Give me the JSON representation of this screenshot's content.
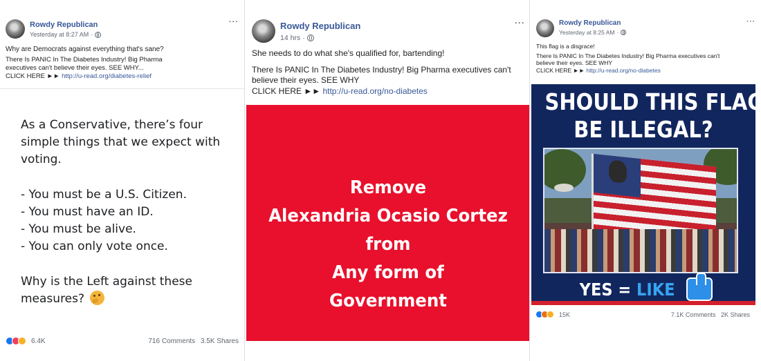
{
  "posts": [
    {
      "page_name": "Rowdy Republican",
      "timestamp": "Yesterday at 8:27 AM",
      "more": "···",
      "caption_question": "Why are Democrats against everything that's sane?",
      "ad_line1": "There Is PANIC In The Diabetes Industry! Big Pharma",
      "ad_line2": "executives can't believe their eyes. SEE WHY...",
      "click_label": "CLICK HERE ►► ",
      "link": "http://u-read.org/diabetes-relief",
      "card_lines": [
        "As a Conservative, there’s four",
        "simple things that we expect with",
        "voting.",
        "",
        "- You must be a U.S. Citizen.",
        "- You must have an ID.",
        "- You must be alive.",
        "- You can only vote once.",
        "",
        "Why is the Left against these",
        "measures?"
      ],
      "reactions": {
        "icons": [
          "like-icon",
          "love-icon",
          "haha-icon"
        ],
        "count": "6.4K"
      },
      "comments": "716 Comments",
      "shares": "3.5K Shares"
    },
    {
      "page_name": "Rowdy Republican",
      "timestamp": "14 hrs",
      "more": "···",
      "caption_question": "She needs to do what she's qualified for, bartending!",
      "ad_line1": "There Is PANIC In The Diabetes Industry! Big Pharma executives can't",
      "ad_line2": "believe their eyes. SEE WHY",
      "click_label": "CLICK HERE ►► ",
      "link": "http://u-read.org/no-diabetes",
      "card_lines": [
        "Remove",
        "Alexandria Ocasio Cortez",
        "from",
        "Any form of",
        "Government"
      ],
      "card_color": "#e8102c"
    },
    {
      "page_name": "Rowdy Republican",
      "timestamp": "Yesterday at 8:25 AM",
      "more": "···",
      "caption_question": "This flag is a disgrace!",
      "ad_line1": "There Is PANIC In The Diabetes Industry! Big Pharma executives can't",
      "ad_line2": "believe their eyes. SEE WHY",
      "click_label": "CLICK HERE ►► ",
      "link": "http://u-read.org/no-diabetes",
      "meme_title_1": "SHOULD THIS FLAG",
      "meme_title_2": "BE ILLEGAL?",
      "meme_yes": "YES = ",
      "meme_like": "LIKE",
      "reactions": {
        "icons": [
          "like-icon",
          "angry-icon",
          "sad-icon"
        ],
        "count": "15K"
      },
      "comments": "7.1K Comments",
      "shares": "2K Shares"
    }
  ],
  "colors": {
    "facebook_link": "#385898",
    "meta_gray": "#606770",
    "red_card": "#e8102c",
    "meme_navy": "#12265e"
  }
}
